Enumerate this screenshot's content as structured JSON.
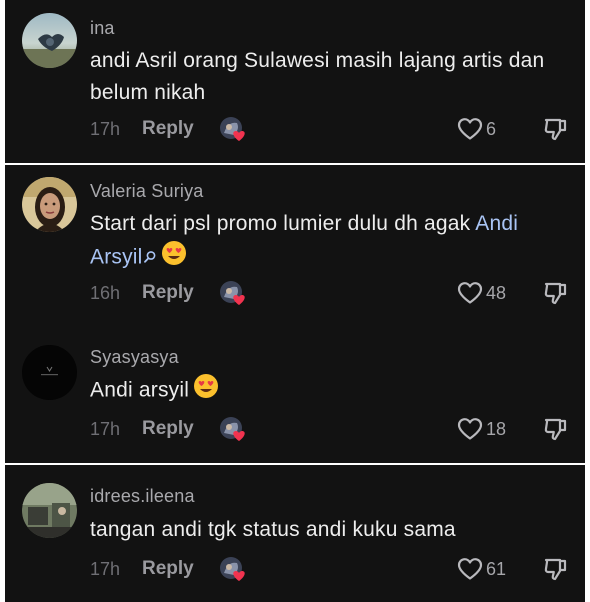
{
  "colors": {
    "background": "#121212",
    "frame": "#ffffff",
    "username": "#a9a9ad",
    "comment_text": "#ededed",
    "mention": "#a9c4f4",
    "meta_text": "#6f6f74",
    "heart_badge": "#f1334f"
  },
  "comments": [
    {
      "username": "ina",
      "text": "andi Asril orang Sulawesi masih lajang artis dan belum nikah",
      "time": "17h",
      "reply_label": "Reply",
      "likes": "6",
      "icons": [
        "creator-liked-avatar-icon",
        "heart-icon",
        "dislike-icon"
      ]
    },
    {
      "username": "Valeria Suriya",
      "text": "Start dari psl promo lumier dulu dh agak ",
      "mention": "Andi Arsyil",
      "time": "16h",
      "reply_label": "Reply",
      "likes": "48",
      "icons": [
        "search-icon",
        "heart-eyes-emoji",
        "creator-liked-avatar-icon",
        "heart-icon",
        "dislike-icon"
      ]
    },
    {
      "username": "Syasyasya",
      "text": "Andi arsyil",
      "time": "17h",
      "reply_label": "Reply",
      "likes": "18",
      "icons": [
        "heart-eyes-emoji",
        "creator-liked-avatar-icon",
        "heart-icon",
        "dislike-icon"
      ]
    },
    {
      "username": "idrees.ileena",
      "text": "tangan andi tgk status andi kuku sama",
      "time": "17h",
      "reply_label": "Reply",
      "likes": "61",
      "icons": [
        "creator-liked-avatar-icon",
        "heart-icon",
        "dislike-icon"
      ]
    }
  ]
}
